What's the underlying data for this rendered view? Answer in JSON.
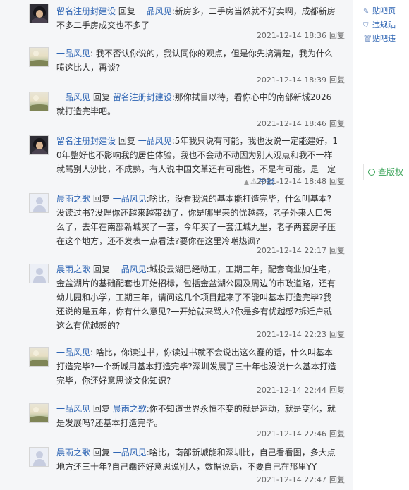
{
  "posts": [
    {
      "avatar": "photo-portrait",
      "author": "留名注册封建设",
      "reply_word": "回复",
      "target": "一品风见",
      "text": ":新房多，二手房当然就不好卖啊，成都新房不多二手房成交也不多了",
      "time": "2021-12-14 18:36",
      "reply_label": "回复"
    },
    {
      "avatar": "landscape",
      "author": "一品风见",
      "text": ": 我不否认你说的，我认同你的观点，但是你先搞清楚，我为什么喷这比人，再谈?",
      "time": "2021-12-14 18:39",
      "reply_label": "回复"
    },
    {
      "avatar": "landscape",
      "author": "一品风见",
      "reply_word": "回复",
      "target": "留名注册封建设",
      "text": ":那你拭目以待，看你心中的南部新城2026就打造完毕吧。",
      "time": "2021-12-14 18:46",
      "reply_label": "回复"
    },
    {
      "avatar": "photo-portrait",
      "author": "留名注册封建设",
      "reply_word": "回复",
      "target": "一品风见",
      "text": ":5年我只说有可能，我也没说一定能建好，10年整好也不影响我的居住体验，我也不会动不动因为别人观点和我不一样就骂别人沙比，不成熟，有人说中国文革还有可能性，不是有可能，是一定",
      "time": "2021-12-14 18:48",
      "reply_label": "回复",
      "report_label": "举报"
    },
    {
      "avatar": "default-user",
      "author": "晨雨之歌",
      "reply_word": "回复",
      "target": "一品风见",
      "text": ":啥比，没看我说的基本能打造完毕，什么叫基本?没读过书?没理你还越来越带劲了，你是哪里来的优越感，老子外来人口怎么了，去年在南部新城买了一套，今年买了一套江城九里，老子两套房子压在这个地方，还不发表一点看法?要你在这里冷嘲热讽?",
      "time": "2021-12-14 22:17",
      "reply_label": "回复"
    },
    {
      "avatar": "default-user",
      "author": "晨雨之歌",
      "reply_word": "回复",
      "target": "一品风见",
      "text": ":城投云湖已经动工，工期三年，配套商业加住宅，金盆湖片的基础配套也开始招标，包括金盆湖公园及周边的市政道路，还有幼儿园和小学，工期三年，请问这几个项目起来了不能叫基本打造完毕?我还说的是五年，你有什么意见?一开始就来骂人?你是多有优越感?拆迁户就这么有优越感的?",
      "time": "2021-12-14 22:23",
      "reply_label": "回复"
    },
    {
      "avatar": "landscape",
      "author": "一品风见",
      "text": ": 啥比，你读过书，你读过书就不会说出这么蠢的话，什么叫基本打造完毕?一个新城用基本打造完毕?深圳发展了三十年也没说什么基本打造完毕，你还好意思谈文化知识?",
      "time": "2021-12-14 22:44",
      "reply_label": "回复"
    },
    {
      "avatar": "landscape",
      "author": "一品风见",
      "reply_word": "回复",
      "target": "晨雨之歌",
      "text": ":你不知道世界永恒不变的就是运动，就是变化，就是发展吗?还基本打造完毕。",
      "time": "2021-12-14 22:46",
      "reply_label": "回复"
    },
    {
      "avatar": "default-user",
      "author": "晨雨之歌",
      "reply_word": "回复",
      "target": "一品风见",
      "text": ":啥比，南部新城能和深圳比，自己看看图，多大点地方还三十年?自己蠢还好意思说别人，数据说话，不要自己在那里YY",
      "time": "2021-12-14 22:47",
      "reply_label": "回复"
    }
  ],
  "sidebar": {
    "links": [
      {
        "icon": "edit-icon",
        "label": "贴吧页"
      },
      {
        "icon": "shield-icon",
        "label": "违规贴"
      },
      {
        "icon": "trash-icon",
        "label": "贴吧违"
      }
    ],
    "copyright_label": "查版权"
  }
}
